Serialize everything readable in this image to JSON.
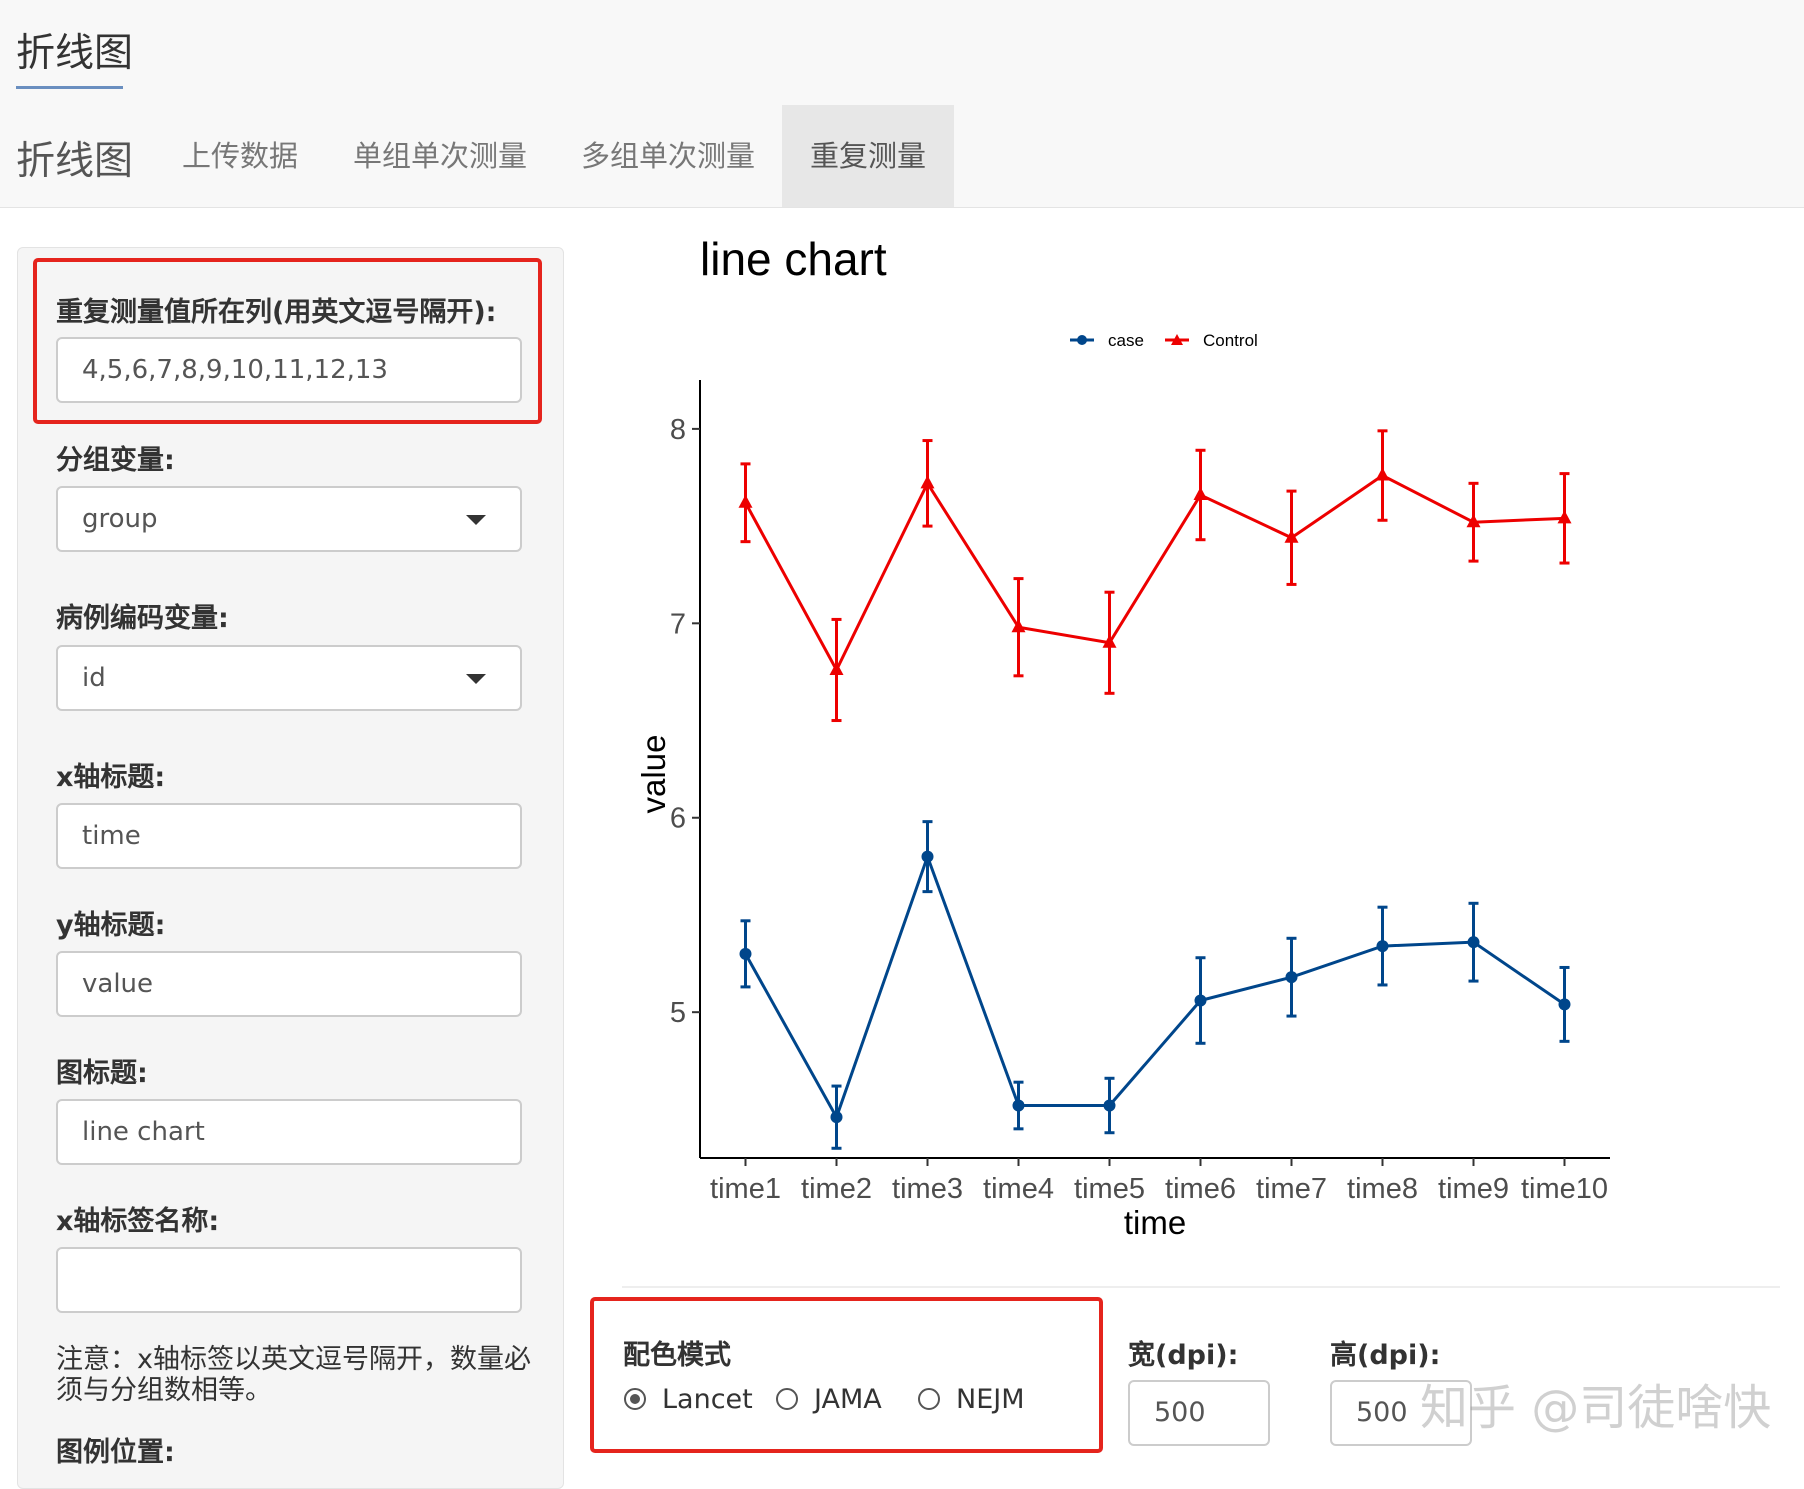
{
  "navbar": {
    "brand_top": "折线图",
    "brand_nav": "折线图",
    "tabs": [
      {
        "label": "上传数据"
      },
      {
        "label": "单组单次测量"
      },
      {
        "label": "多组单次测量"
      },
      {
        "label": "重复测量",
        "active": true
      }
    ]
  },
  "sidebar": {
    "repeat_cols_label": "重复测量值所在列(用英文逗号隔开):",
    "repeat_cols_value": "4,5,6,7,8,9,10,11,12,13",
    "group_label": "分组变量:",
    "group_value": "group",
    "id_label": "病例编码变量:",
    "id_value": "id",
    "xtitle_label": "x轴标题:",
    "xtitle_value": "time",
    "ytitle_label": "y轴标题:",
    "ytitle_value": "value",
    "title_label": "图标题:",
    "title_value": "line chart",
    "xtick_label": "x轴标签名称:",
    "xtick_value": "",
    "note": "注意：x轴标签以英文逗号隔开，数量必须与分组数相等。",
    "legend_pos_label": "图例位置:"
  },
  "chart_data": {
    "type": "line",
    "title": "line chart",
    "xlabel": "time",
    "ylabel": "value",
    "categories": [
      "time1",
      "time2",
      "time3",
      "time4",
      "time5",
      "time6",
      "time7",
      "time8",
      "time9",
      "time10"
    ],
    "y_ticks": [
      5,
      6,
      7,
      8
    ],
    "ylim": [
      4.25,
      8.2
    ],
    "legend_position": "top",
    "series": [
      {
        "name": "case",
        "color": "#00468B",
        "marker": "circle",
        "values": [
          5.3,
          4.46,
          5.8,
          4.52,
          4.52,
          5.06,
          5.18,
          5.34,
          5.36,
          5.04
        ],
        "errors": [
          0.17,
          0.16,
          0.18,
          0.12,
          0.14,
          0.22,
          0.2,
          0.2,
          0.2,
          0.19
        ]
      },
      {
        "name": "Control",
        "color": "#ED0000",
        "marker": "triangle",
        "values": [
          7.62,
          6.76,
          7.72,
          6.98,
          6.9,
          7.66,
          7.44,
          7.76,
          7.52,
          7.54
        ],
        "errors": [
          0.2,
          0.26,
          0.22,
          0.25,
          0.26,
          0.23,
          0.24,
          0.23,
          0.2,
          0.23
        ]
      }
    ]
  },
  "options": {
    "color_mode_label": "配色模式",
    "color_modes": [
      {
        "label": "Lancet",
        "checked": true
      },
      {
        "label": "JAMA",
        "checked": false
      },
      {
        "label": "NEJM",
        "checked": false
      }
    ],
    "width_label": "宽(dpi):",
    "width_value": "500",
    "height_label": "高(dpi):",
    "height_value": "500"
  },
  "watermark": "知乎 @司徒啥快"
}
